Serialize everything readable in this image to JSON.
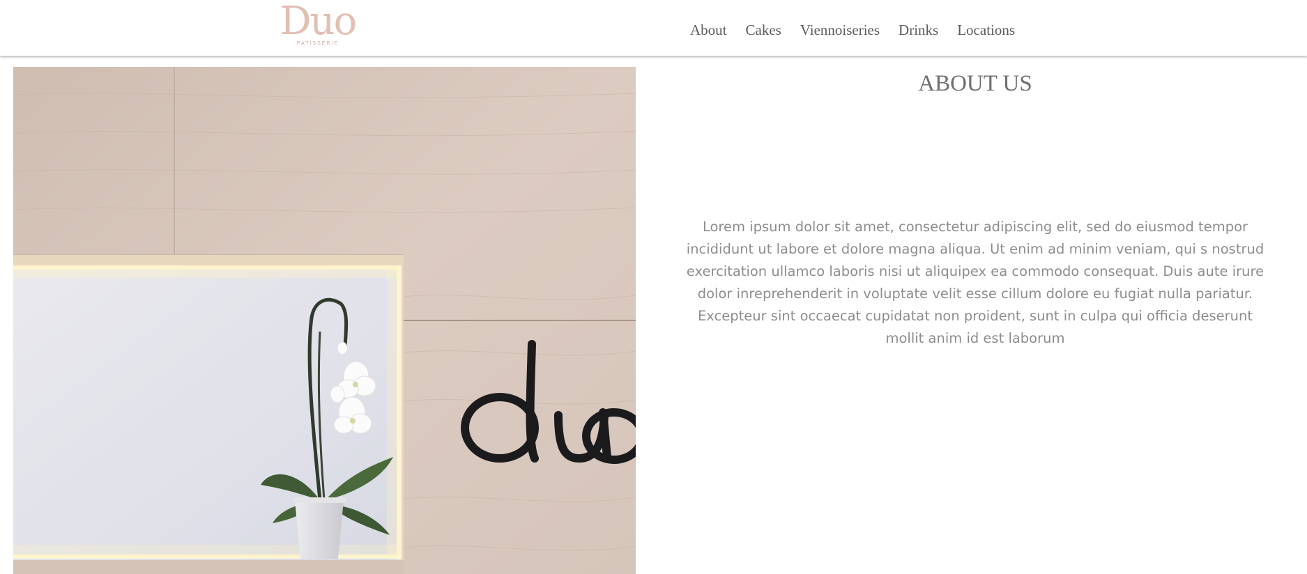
{
  "header": {
    "logo": {
      "word": "Duo",
      "subtitle": "PATISSERIE",
      "icon": "duo-patisserie-logo"
    },
    "nav": [
      {
        "label": "About"
      },
      {
        "label": "Cakes"
      },
      {
        "label": "Viennoiseries"
      },
      {
        "label": "Drinks"
      },
      {
        "label": "Locations"
      }
    ]
  },
  "hero": {
    "image": "storefront-wall-with-orchid-and-duo-sign",
    "sign_text": "duo"
  },
  "about": {
    "title": "ABOUT US",
    "body": "Lorem ipsum dolor sit amet, consectetur adipiscing elit, sed do eiusmod tempor incididunt ut labore et dolore magna aliqua. Ut enim ad minim veniam, qui s nostrud exercitation ullamco laboris nisi ut aliquipex ea commodo consequat. Duis aute irure dolor inreprehenderit in voluptate velit esse cillum dolore eu fugiat nulla pariatur. Excepteur sint occaecat cupidatat non proident, sunt in culpa qui officia deserunt mollit anim id est laborum"
  },
  "colors": {
    "logo": "#e2bfb3",
    "nav_text": "#5c5c5c",
    "title_text": "#6f6f6f",
    "body_text": "#8d8d8d",
    "wood": "#dbcac0",
    "niche": "#e6e6ec",
    "led": "#fff2c2"
  }
}
